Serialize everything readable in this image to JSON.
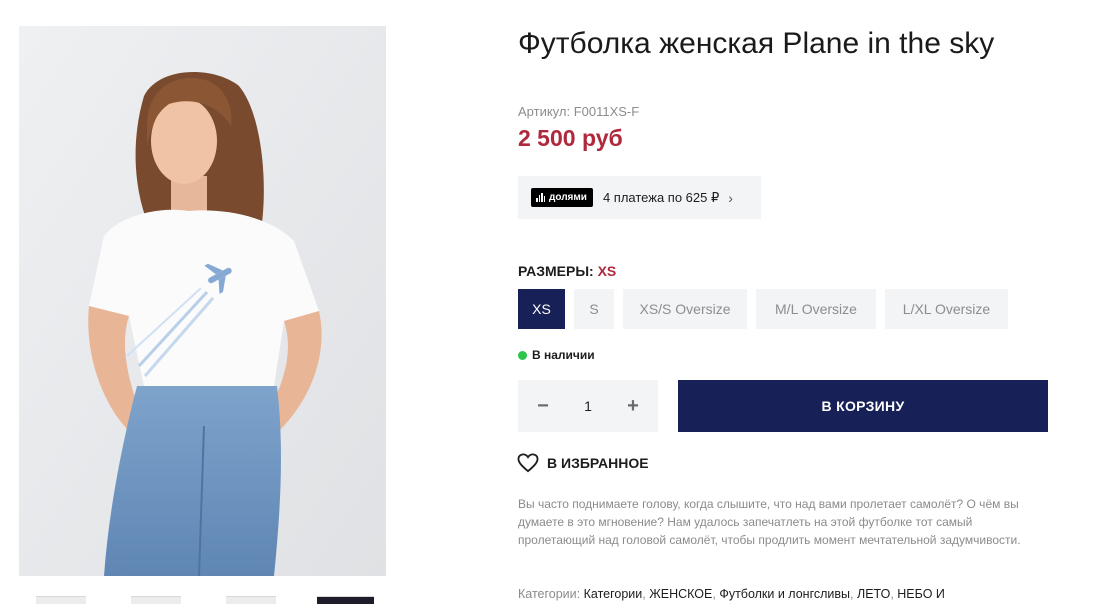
{
  "product": {
    "title": "Футболка женская Plane in the sky",
    "sku": "Артикул: F0011XS-F",
    "price": "2 500 руб"
  },
  "dolyami": {
    "logo_text": "долями",
    "text": "4 платежа по 625 ₽",
    "chevron": "›"
  },
  "sizes": {
    "label": "РАЗМЕРЫ:",
    "selected": "XS",
    "options": [
      "XS",
      "S",
      "XS/S Oversize",
      "M/L Oversize",
      "L/XL Oversize"
    ]
  },
  "stock": {
    "text": "В наличии",
    "color": "#2bc54a"
  },
  "quantity": {
    "minus": "−",
    "value": "1",
    "plus": "+"
  },
  "cart_button": "В КОРЗИНУ",
  "favorite": {
    "icon": "heart-icon",
    "label": "В ИЗБРАННОЕ"
  },
  "description": "Вы часто поднимаете голову, когда слышите, что над вами пролетает самолёт? О чём вы думаете в это мгновение? Нам удалось запечатлеть на этой футболке тот самый пролетающий над головой самолёт, чтобы продлить момент мечтательной задумчивости.",
  "categories": {
    "label": "Категории:",
    "items": [
      "Категории",
      "ЖЕНСКОЕ",
      "Футболки и лонгсливы",
      "ЛЕТО",
      "НЕБО И"
    ]
  },
  "colors": {
    "accent": "#172057",
    "price": "#b0283b",
    "panel": "#f3f4f6"
  }
}
